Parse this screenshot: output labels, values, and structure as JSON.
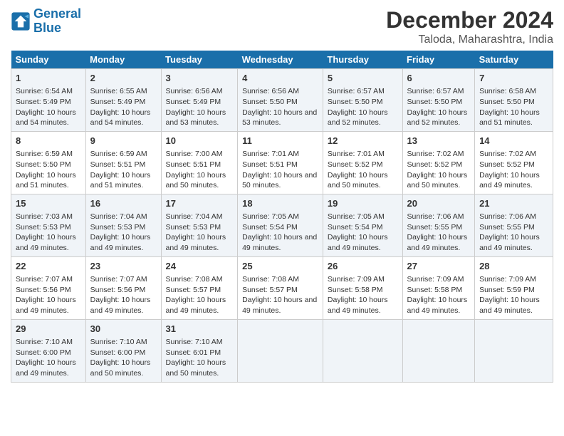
{
  "logo": {
    "text_general": "General",
    "text_blue": "Blue"
  },
  "title": "December 2024",
  "subtitle": "Taloda, Maharashtra, India",
  "headers": [
    "Sunday",
    "Monday",
    "Tuesday",
    "Wednesday",
    "Thursday",
    "Friday",
    "Saturday"
  ],
  "weeks": [
    [
      {
        "day": "1",
        "sunrise": "6:54 AM",
        "sunset": "5:49 PM",
        "daylight": "10 hours and 54 minutes."
      },
      {
        "day": "2",
        "sunrise": "6:55 AM",
        "sunset": "5:49 PM",
        "daylight": "10 hours and 54 minutes."
      },
      {
        "day": "3",
        "sunrise": "6:56 AM",
        "sunset": "5:49 PM",
        "daylight": "10 hours and 53 minutes."
      },
      {
        "day": "4",
        "sunrise": "6:56 AM",
        "sunset": "5:50 PM",
        "daylight": "10 hours and 53 minutes."
      },
      {
        "day": "5",
        "sunrise": "6:57 AM",
        "sunset": "5:50 PM",
        "daylight": "10 hours and 52 minutes."
      },
      {
        "day": "6",
        "sunrise": "6:57 AM",
        "sunset": "5:50 PM",
        "daylight": "10 hours and 52 minutes."
      },
      {
        "day": "7",
        "sunrise": "6:58 AM",
        "sunset": "5:50 PM",
        "daylight": "10 hours and 51 minutes."
      }
    ],
    [
      {
        "day": "8",
        "sunrise": "6:59 AM",
        "sunset": "5:50 PM",
        "daylight": "10 hours and 51 minutes."
      },
      {
        "day": "9",
        "sunrise": "6:59 AM",
        "sunset": "5:51 PM",
        "daylight": "10 hours and 51 minutes."
      },
      {
        "day": "10",
        "sunrise": "7:00 AM",
        "sunset": "5:51 PM",
        "daylight": "10 hours and 50 minutes."
      },
      {
        "day": "11",
        "sunrise": "7:01 AM",
        "sunset": "5:51 PM",
        "daylight": "10 hours and 50 minutes."
      },
      {
        "day": "12",
        "sunrise": "7:01 AM",
        "sunset": "5:52 PM",
        "daylight": "10 hours and 50 minutes."
      },
      {
        "day": "13",
        "sunrise": "7:02 AM",
        "sunset": "5:52 PM",
        "daylight": "10 hours and 50 minutes."
      },
      {
        "day": "14",
        "sunrise": "7:02 AM",
        "sunset": "5:52 PM",
        "daylight": "10 hours and 49 minutes."
      }
    ],
    [
      {
        "day": "15",
        "sunrise": "7:03 AM",
        "sunset": "5:53 PM",
        "daylight": "10 hours and 49 minutes."
      },
      {
        "day": "16",
        "sunrise": "7:04 AM",
        "sunset": "5:53 PM",
        "daylight": "10 hours and 49 minutes."
      },
      {
        "day": "17",
        "sunrise": "7:04 AM",
        "sunset": "5:53 PM",
        "daylight": "10 hours and 49 minutes."
      },
      {
        "day": "18",
        "sunrise": "7:05 AM",
        "sunset": "5:54 PM",
        "daylight": "10 hours and 49 minutes."
      },
      {
        "day": "19",
        "sunrise": "7:05 AM",
        "sunset": "5:54 PM",
        "daylight": "10 hours and 49 minutes."
      },
      {
        "day": "20",
        "sunrise": "7:06 AM",
        "sunset": "5:55 PM",
        "daylight": "10 hours and 49 minutes."
      },
      {
        "day": "21",
        "sunrise": "7:06 AM",
        "sunset": "5:55 PM",
        "daylight": "10 hours and 49 minutes."
      }
    ],
    [
      {
        "day": "22",
        "sunrise": "7:07 AM",
        "sunset": "5:56 PM",
        "daylight": "10 hours and 49 minutes."
      },
      {
        "day": "23",
        "sunrise": "7:07 AM",
        "sunset": "5:56 PM",
        "daylight": "10 hours and 49 minutes."
      },
      {
        "day": "24",
        "sunrise": "7:08 AM",
        "sunset": "5:57 PM",
        "daylight": "10 hours and 49 minutes."
      },
      {
        "day": "25",
        "sunrise": "7:08 AM",
        "sunset": "5:57 PM",
        "daylight": "10 hours and 49 minutes."
      },
      {
        "day": "26",
        "sunrise": "7:09 AM",
        "sunset": "5:58 PM",
        "daylight": "10 hours and 49 minutes."
      },
      {
        "day": "27",
        "sunrise": "7:09 AM",
        "sunset": "5:58 PM",
        "daylight": "10 hours and 49 minutes."
      },
      {
        "day": "28",
        "sunrise": "7:09 AM",
        "sunset": "5:59 PM",
        "daylight": "10 hours and 49 minutes."
      }
    ],
    [
      {
        "day": "29",
        "sunrise": "7:10 AM",
        "sunset": "6:00 PM",
        "daylight": "10 hours and 49 minutes."
      },
      {
        "day": "30",
        "sunrise": "7:10 AM",
        "sunset": "6:00 PM",
        "daylight": "10 hours and 50 minutes."
      },
      {
        "day": "31",
        "sunrise": "7:10 AM",
        "sunset": "6:01 PM",
        "daylight": "10 hours and 50 minutes."
      },
      null,
      null,
      null,
      null
    ]
  ],
  "labels": {
    "sunrise": "Sunrise:",
    "sunset": "Sunset:",
    "daylight": "Daylight:"
  }
}
